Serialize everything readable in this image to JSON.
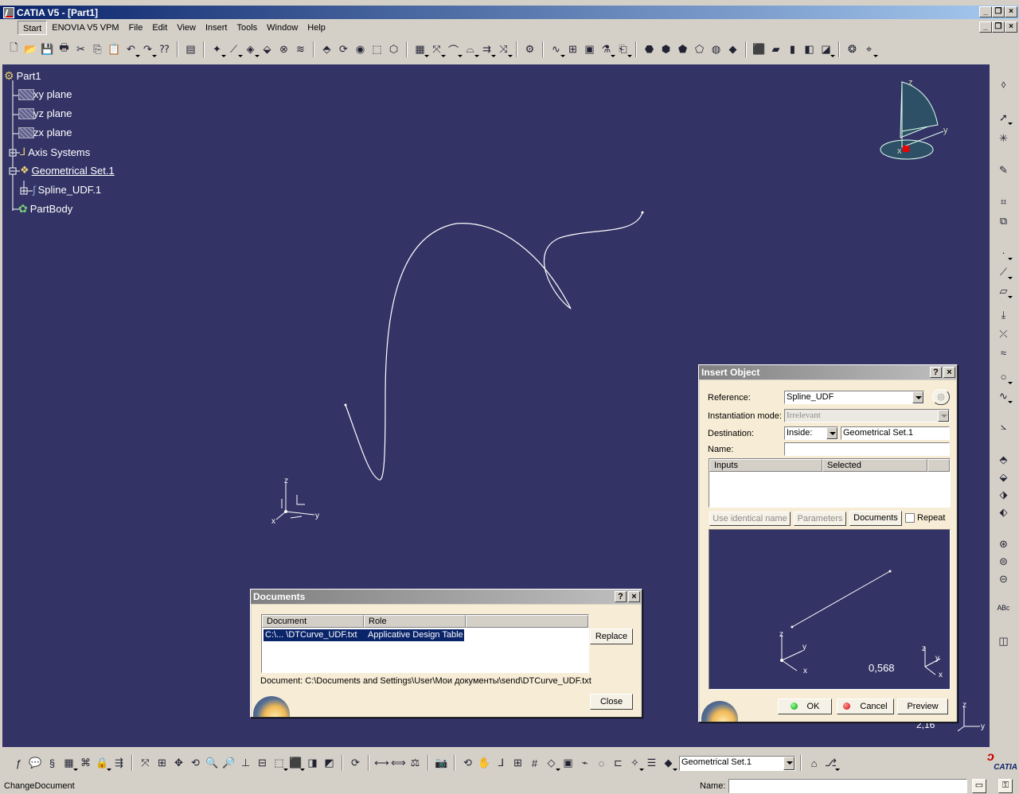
{
  "window": {
    "title": "CATIA V5 - [Part1]"
  },
  "menu": [
    "Start",
    "ENOVIA V5 VPM",
    "File",
    "Edit",
    "View",
    "Insert",
    "Tools",
    "Window",
    "Help"
  ],
  "tree": {
    "root": "Part1",
    "items": [
      "xy plane",
      "yz plane",
      "zx plane",
      "Axis Systems",
      "Geometrical Set.1",
      "Spline_UDF.1",
      "PartBody"
    ]
  },
  "compass": {
    "z": "z",
    "y": "y",
    "x": "x"
  },
  "axis_labels": {
    "z": "z",
    "y": "y",
    "x": "x"
  },
  "insert_object": {
    "title": "Insert Object",
    "help": "?",
    "close": "×",
    "reference_label": "Reference:",
    "reference_value": "Spline_UDF",
    "instantiation_label": "Instantiation mode:",
    "instantiation_value": "Irrelevant",
    "destination_label": "Destination:",
    "destination_mode": "Inside:",
    "destination_value": "Geometrical Set.1",
    "name_label": "Name:",
    "name_value": "",
    "col_inputs": "Inputs",
    "col_selected": "Selected",
    "use_identical": "Use identical name",
    "parameters": "Parameters",
    "documents": "Documents",
    "repeat": "Repeat",
    "preview_value": "0,568",
    "ok": "OK",
    "cancel": "Cancel",
    "preview": "Preview"
  },
  "viewport_scale": "2,16",
  "documents": {
    "title": "Documents",
    "help": "?",
    "close": "×",
    "col_document": "Document",
    "col_role": "Role",
    "row_document": "C:\\... \\DTCurve_UDF.txt",
    "row_role": "Applicative Design Table",
    "replace": "Replace",
    "path_text": "Document: C:\\Documents and Settings\\User\\Мои документы\\send\\DTCurve_UDF.txt",
    "close_btn": "Close"
  },
  "bottom_toolbar": {
    "combo_value": "Geometrical Set.1",
    "brand": "CATIA"
  },
  "status": {
    "message": "ChangeDocument",
    "name_label": "Name:"
  },
  "colors": {
    "viewport": "#333366",
    "title_active": "#0a246a",
    "dialog_body": "#f7ecd5"
  }
}
